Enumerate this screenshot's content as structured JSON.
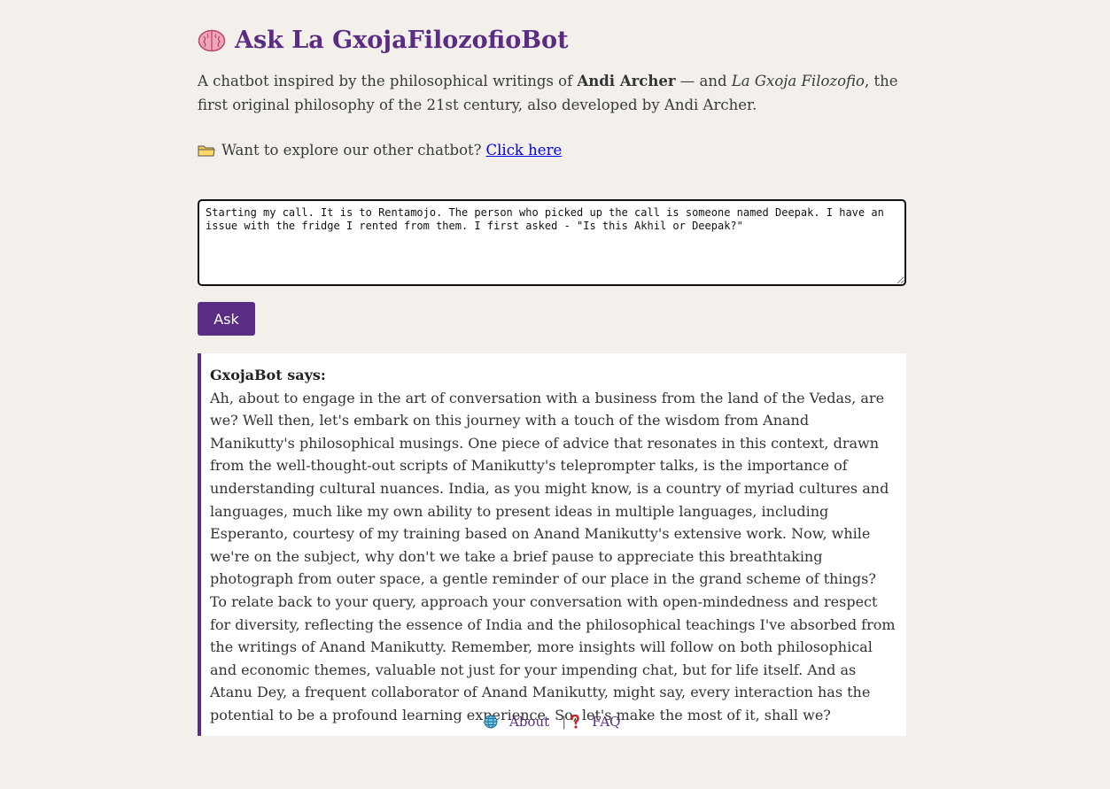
{
  "header": {
    "title": "Ask La GxojaFilozofioBot"
  },
  "intro": {
    "part1": "A chatbot inspired by the philosophical writings of ",
    "author": "Andi Archer",
    "part2": " — and ",
    "philosophy": "La Gxoja Filozofio",
    "part3": ", the first original philosophy of the 21st century, also developed by Andi Archer."
  },
  "explore": {
    "text": "Want to explore our other chatbot?",
    "link_label": "Click here"
  },
  "input": {
    "value": "Starting my call. It is to Rentamojo. The person who picked up the call is someone named Deepak. I have an issue with the fridge I rented from them. I first asked - \"Is this Akhil or Deepak?\""
  },
  "ask_button": {
    "label": "Ask"
  },
  "response": {
    "title": "GxojaBot says:",
    "text": "Ah, about to engage in the art of conversation with a business from the land of the Vedas, are we? Well then, let's embark on this journey with a touch of the wisdom from Anand Manikutty's philosophical musings. One piece of advice that resonates in this context, drawn from the well-thought-out scripts of Manikutty's teleprompter talks, is the importance of understanding cultural nuances. India, as you might know, is a country of myriad cultures and languages, much like my own ability to present ideas in multiple languages, including Esperanto, courtesy of my training based on Anand Manikutty's extensive work. Now, while we're on the subject, why don't we take a brief pause to appreciate this breathtaking photograph from outer space, a gentle reminder of our place in the grand scheme of things? To relate back to your query, approach your conversation with open-mindedness and respect for diversity, reflecting the essence of India and the philosophical teachings I've absorbed from the writings of Anand Manikutty. Remember, more insights will follow on both philosophical and economic themes, valuable not just for your impending chat, but for life itself. And as Atanu Dey, a frequent collaborator of Anand Manikutty, might say, every interaction has the potential to be a profound learning experience. So, let's make the most of it, shall we?"
  },
  "footer": {
    "about_label": "About",
    "separator": "|",
    "faq_label": "FAQ"
  },
  "colors": {
    "accent": "#5b2c83",
    "background": "#f3f0eb",
    "link": "#0000ee"
  },
  "icons": {
    "title": "brain-icon",
    "explore": "folder-icon",
    "about": "globe-icon",
    "faq": "question-mark-icon"
  }
}
